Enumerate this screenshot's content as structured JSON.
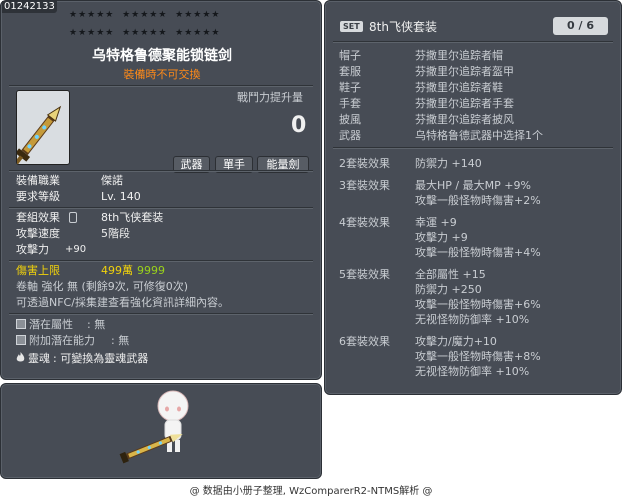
{
  "item": {
    "code": "01242133",
    "name": "乌特格鲁德聚能锁链剑",
    "trade_status": "裝備時不可交換",
    "combat_power_label": "戰鬥力提升量",
    "combat_power_value": "0",
    "tags": [
      "武器",
      "單手",
      "能量劍"
    ],
    "stats": {
      "job_label": "裝備職業",
      "job_value": "傑諾",
      "level_label": "要求等級",
      "level_value": "Lv. 140",
      "set_label": "套組效果",
      "set_value": "8th飞侠套装",
      "speed_label": "攻擊速度",
      "speed_value": "5階段",
      "attack_label": "攻擊力",
      "attack_value": "+90",
      "damage_cap_label": "傷害上限",
      "damage_cap_value": "499萬",
      "damage_cap_extra": "9999",
      "scroll_line": "卷軸 強化 無 (剩餘9次, 可修復0次)",
      "npc_line": "可透過NFC/採集建查看強化資訊詳細內容。"
    },
    "potential_label": "潛在屬性",
    "potential_value": ": 無",
    "additional_label": "附加潛在能力",
    "additional_value": ": 無",
    "soul_label": "靈魂",
    "soul_value": ": 可變換為靈魂武器"
  },
  "set": {
    "badge": "SET",
    "name": "8th飞侠套装",
    "count": "0 / 6",
    "pieces": [
      {
        "slot": "帽子",
        "name": "芬撒里尔追踪者帽"
      },
      {
        "slot": "套服",
        "name": "芬撒里尔追踪者盔甲"
      },
      {
        "slot": "鞋子",
        "name": "芬撒里尔追踪者鞋"
      },
      {
        "slot": "手套",
        "name": "芬撒里尔追踪者手套"
      },
      {
        "slot": "披風",
        "name": "芬撒里尔追踪者披风"
      },
      {
        "slot": "武器",
        "name": "乌特格鲁德武器中选择1个"
      }
    ],
    "effects": [
      {
        "label": "2套裝效果",
        "lines": [
          "防禦力   +140"
        ]
      },
      {
        "label": "3套裝效果",
        "lines": [
          "最大HP / 最大MP   +9%",
          "攻擊一般怪物時傷害+2%"
        ]
      },
      {
        "label": "4套裝效果",
        "lines": [
          "幸運   +9",
          "攻擊力   +9",
          "攻擊一般怪物時傷害+4%"
        ]
      },
      {
        "label": "5套裝效果",
        "lines": [
          "全部屬性   +15",
          "防禦力   +250",
          "攻擊一般怪物時傷害+6%",
          "无视怪物防御率   +10%"
        ]
      },
      {
        "label": "6套裝效果",
        "lines": [
          "攻擊力/魔力+10",
          "攻擊一般怪物時傷害+8%",
          "无视怪物防御率   +10%"
        ]
      }
    ]
  },
  "footer": "@ 数据由小册子整理, WzComparerR2-NTMS解析 @"
}
